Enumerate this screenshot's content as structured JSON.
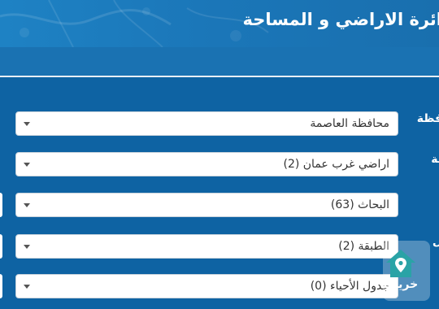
{
  "header": {
    "title": "ائرة الاراضي و المساحة"
  },
  "form": {
    "fields": [
      {
        "label": "فظة",
        "value": "محافظة العاصمة"
      },
      {
        "label": "ية",
        "value": "اراضي غرب عمان (2)"
      },
      {
        "label": "",
        "value": "البحاث (63)"
      },
      {
        "label": "ل",
        "value": "الطبقة (2)"
      },
      {
        "label": "",
        "value": "جدول الأحياء (0)"
      }
    ]
  },
  "map_widget": {
    "label": "خريطة",
    "icon": "home-location-icon"
  },
  "colors": {
    "background": "#0e63a3",
    "header": "#1b77b9",
    "divider": "#e7eef5",
    "widget_icon": "#29a3a3"
  }
}
